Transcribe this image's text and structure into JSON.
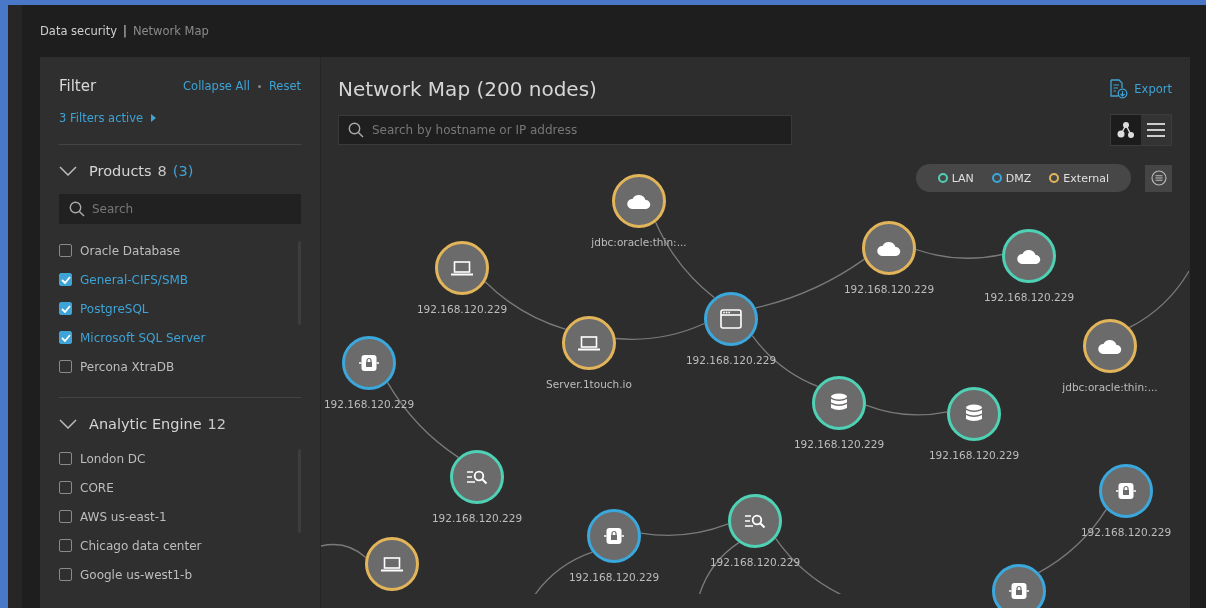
{
  "breadcrumb": {
    "separator": "|",
    "items": [
      {
        "label": "Data security",
        "selected": false
      },
      {
        "label": "Network Map",
        "selected": true
      }
    ]
  },
  "filter": {
    "title": "Filter",
    "actions": [
      "Collapse All",
      "Reset"
    ],
    "active_summary": "3 Filters active",
    "sections": [
      {
        "title": "Products",
        "count": "8",
        "selected_count": "(3)",
        "expanded": true,
        "search_placeholder": "Search",
        "items": [
          {
            "label": "Oracle Database",
            "checked": false
          },
          {
            "label": "General-CIFS/SMB",
            "checked": true
          },
          {
            "label": "PostgreSQL",
            "checked": true
          },
          {
            "label": "Microsoft SQL Server",
            "checked": true
          },
          {
            "label": "Percona XtraDB",
            "checked": false
          }
        ]
      },
      {
        "title": "Analytic Engine",
        "count": "12",
        "expanded": true,
        "items": [
          {
            "label": "London DC",
            "checked": false
          },
          {
            "label": "CORE",
            "checked": false
          },
          {
            "label": "AWS us-east-1",
            "checked": false
          },
          {
            "label": "Chicago data center",
            "checked": false
          },
          {
            "label": "Google us-west1-b",
            "checked": false
          }
        ]
      }
    ]
  },
  "map": {
    "title": "Network Map (200 nodes)",
    "export_label": "Export",
    "search_placeholder": "Search by hostname or IP address",
    "views": [
      {
        "kind": "graph",
        "selected": true
      },
      {
        "kind": "list",
        "selected": false
      }
    ],
    "legend": [
      {
        "label": "LAN",
        "color": "#4fd1b5"
      },
      {
        "label": "DMZ",
        "color": "#3aa8dc"
      },
      {
        "label": "External",
        "color": "#e3b55a"
      }
    ],
    "nodes": [
      {
        "label": "jdbc:oracle:thin:...",
        "kind": "cloud",
        "color": "#e3b55a"
      },
      {
        "label": "192.168.120.229",
        "kind": "laptop",
        "color": "#e3b55a"
      },
      {
        "label": "Server.1touch.io",
        "kind": "laptop",
        "color": "#e3b55a"
      },
      {
        "label": "192.168.120.229",
        "kind": "browser",
        "color": "#3aa8dc"
      },
      {
        "label": "192.168.120.229",
        "kind": "cloud",
        "color": "#e3b55a"
      },
      {
        "label": "192.168.120.229",
        "kind": "cloud",
        "color": "#4fd1b5"
      },
      {
        "label": "jdbc:oracle:thin:...",
        "kind": "cloud",
        "color": "#e3b55a"
      },
      {
        "label": "192.168.120.229",
        "kind": "lock",
        "color": "#3aa8dc"
      },
      {
        "label": "192.168.120.229",
        "kind": "search",
        "color": "#4fd1b5"
      },
      {
        "label": "192.168.120.229",
        "kind": "database",
        "color": "#4fd1b5"
      },
      {
        "label": "192.168.120.229",
        "kind": "database",
        "color": "#4fd1b5"
      },
      {
        "label": "192.168.120.229",
        "kind": "lock",
        "color": "#3aa8dc"
      },
      {
        "label": "192.168.120.229",
        "kind": "search",
        "color": "#4fd1b5"
      },
      {
        "label": "192.168.120.229",
        "kind": "lock",
        "color": "#3aa8dc"
      },
      {
        "kind": "laptop",
        "color": "#e3b55a"
      },
      {
        "kind": "lock",
        "color": "#3aa8dc"
      }
    ]
  }
}
